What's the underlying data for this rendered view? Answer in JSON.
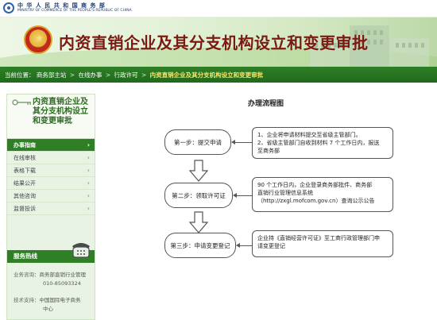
{
  "header": {
    "ministry_cn": "中 华 人 民 共 和 国 商 务 部",
    "ministry_en": "MINISTRY OF COMMERCE OF THE PEOPLE'S REPUBLIC OF CHINA",
    "banner_title": "内资直销企业及其分支机构设立和变更审批"
  },
  "breadcrumb": {
    "prefix": "当前位置：",
    "items": [
      "商务部主站",
      "在线办事",
      "行政许可",
      "内资直销企业及其分支机构设立和变更审批"
    ],
    "separator": ">"
  },
  "sidebar": {
    "title": "内资直销企业及其分支机构设立和变更审批",
    "nav": [
      {
        "label": "办事指南",
        "active": true
      },
      {
        "label": "在线审核",
        "active": false
      },
      {
        "label": "表格下载",
        "active": false
      },
      {
        "label": "结果公开",
        "active": false
      },
      {
        "label": "其他咨询",
        "active": false
      },
      {
        "label": "监督投诉",
        "active": false
      }
    ],
    "hotline": {
      "title": "服务热线",
      "consult_label": "业务咨询：",
      "consult_org": "商务部直销行业管理",
      "consult_phone": "010-85093324",
      "support_label": "技术支持：",
      "support_org_1": "中国国际电子商务",
      "support_org_2": "中心"
    }
  },
  "flow": {
    "title": "办理流程图",
    "steps": [
      {
        "label": "第一步：提交申请"
      },
      {
        "label": "第二步：领取许可证"
      },
      {
        "label": "第三步：申请变更登记"
      }
    ],
    "notes": [
      {
        "lines": [
          "1、企业将申请材料提交至省级主管部门。",
          "2、省级主管部门自收到材料 7 个工作日内，报送",
          "至商务部"
        ]
      },
      {
        "lines": [
          "90 个工作日内，企业登录商务部批件、商务部",
          "直销行业管理信息系统",
          "（http://zxgl.mofcom.gov.cn）查询公示公告"
        ]
      },
      {
        "lines": [
          "企业持《直销经营许可证》至工商行政管理部门申",
          "请变更登记"
        ]
      }
    ]
  },
  "colors": {
    "accent_green": "#2f7f27",
    "title_red": "#7a1b12",
    "breadcrumb_current": "#ffe36a"
  }
}
